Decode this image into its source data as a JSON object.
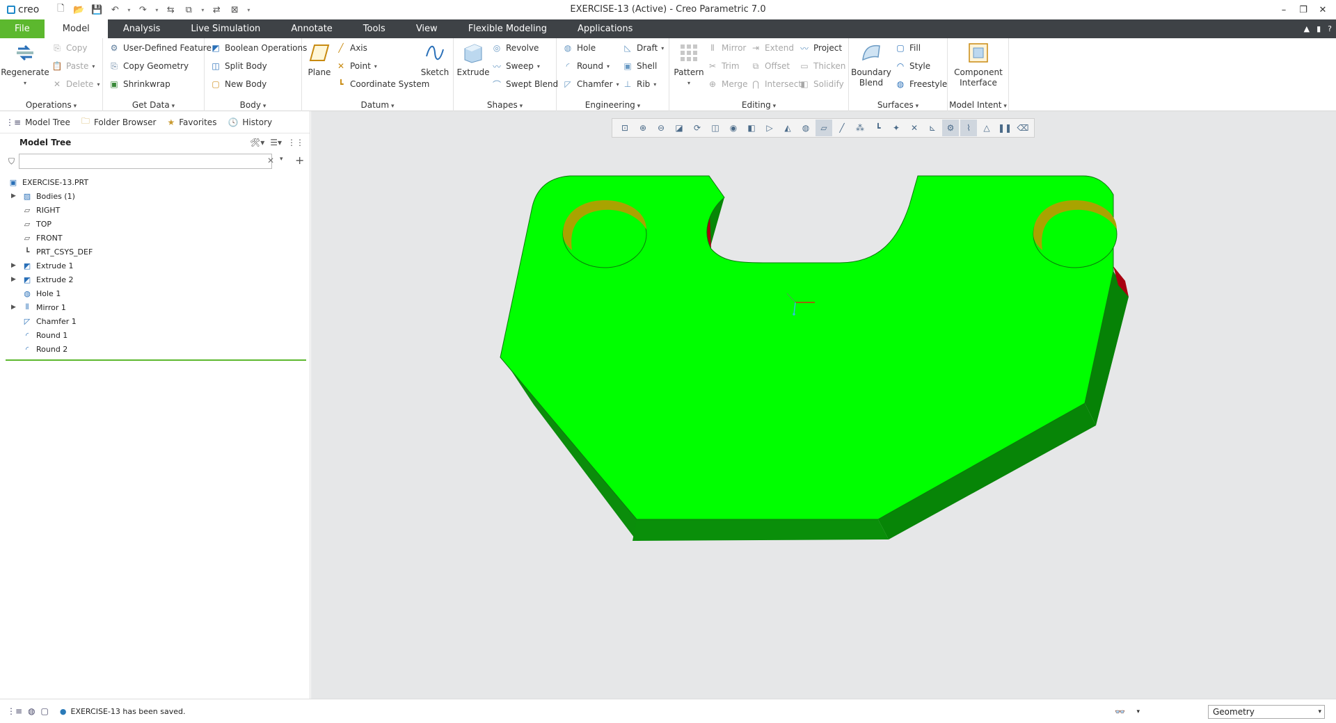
{
  "app": {
    "logo": "creo",
    "title": "EXERCISE-13 (Active) - Creo Parametric 7.0",
    "window_controls": [
      "–",
      "❐",
      "✕"
    ]
  },
  "tabs": [
    {
      "label": "File"
    },
    {
      "label": "Model"
    },
    {
      "label": "Analysis"
    },
    {
      "label": "Live Simulation"
    },
    {
      "label": "Annotate"
    },
    {
      "label": "Tools"
    },
    {
      "label": "View"
    },
    {
      "label": "Flexible Modeling"
    },
    {
      "label": "Applications"
    }
  ],
  "ribbon": {
    "operations": {
      "label": "Operations",
      "regenerate": "Regenerate",
      "copy": "Copy",
      "paste": "Paste",
      "delete": "Delete"
    },
    "get_data": {
      "label": "Get Data",
      "udf": "User-Defined Feature",
      "copy_geometry": "Copy Geometry",
      "shrinkwrap": "Shrinkwrap"
    },
    "body": {
      "label": "Body",
      "boolean": "Boolean Operations",
      "split": "Split Body",
      "new": "New Body"
    },
    "datum": {
      "label": "Datum",
      "plane": "Plane",
      "axis": "Axis",
      "point": "Point",
      "csys": "Coordinate System",
      "sketch": "Sketch"
    },
    "shapes": {
      "label": "Shapes",
      "extrude": "Extrude",
      "revolve": "Revolve",
      "sweep": "Sweep",
      "swept_blend": "Swept Blend"
    },
    "engineering": {
      "label": "Engineering",
      "hole": "Hole",
      "round": "Round",
      "chamfer": "Chamfer",
      "draft": "Draft",
      "shell": "Shell",
      "rib": "Rib"
    },
    "editing": {
      "label": "Editing",
      "pattern": "Pattern",
      "mirror": "Mirror",
      "trim": "Trim",
      "merge": "Merge",
      "extend": "Extend",
      "offset": "Offset",
      "intersect": "Intersect",
      "project": "Project",
      "thicken": "Thicken",
      "solidify": "Solidify"
    },
    "surfaces": {
      "label": "Surfaces",
      "boundary_blend_1": "Boundary",
      "boundary_blend_2": "Blend",
      "fill": "Fill",
      "style": "Style",
      "freestyle": "Freestyle"
    },
    "model_intent": {
      "label": "Model Intent",
      "component_1": "Component",
      "component_2": "Interface"
    }
  },
  "nav_tabs": [
    "Model Tree",
    "Folder Browser",
    "Favorites",
    "History"
  ],
  "model_tree": {
    "title": "Model Tree",
    "search_placeholder": "",
    "items": [
      {
        "label": "EXERCISE-13.PRT",
        "icon": "part-icon",
        "indent": 0,
        "expandable": false
      },
      {
        "label": "Bodies (1)",
        "icon": "bodies-icon",
        "indent": 1,
        "expandable": true
      },
      {
        "label": "RIGHT",
        "icon": "datum-plane-icon",
        "indent": 1,
        "expandable": false
      },
      {
        "label": "TOP",
        "icon": "datum-plane-icon",
        "indent": 1,
        "expandable": false
      },
      {
        "label": "FRONT",
        "icon": "datum-plane-icon",
        "indent": 1,
        "expandable": false
      },
      {
        "label": "PRT_CSYS_DEF",
        "icon": "csys-icon",
        "indent": 1,
        "expandable": false
      },
      {
        "label": "Extrude 1",
        "icon": "extrude-icon",
        "indent": 1,
        "expandable": true
      },
      {
        "label": "Extrude 2",
        "icon": "extrude-icon",
        "indent": 1,
        "expandable": true
      },
      {
        "label": "Hole 1",
        "icon": "hole-icon",
        "indent": 1,
        "expandable": false
      },
      {
        "label": "Mirror 1",
        "icon": "mirror-icon",
        "indent": 1,
        "expandable": true
      },
      {
        "label": "Chamfer 1",
        "icon": "chamfer-icon",
        "indent": 1,
        "expandable": false
      },
      {
        "label": "Round 1",
        "icon": "round-icon",
        "indent": 1,
        "expandable": false
      },
      {
        "label": "Round 2",
        "icon": "round-icon",
        "indent": 1,
        "expandable": false
      }
    ]
  },
  "status": {
    "message": "EXERCISE-13 has been saved.",
    "filter": "Geometry"
  },
  "colors": {
    "file_tab": "#5cb82e",
    "tabbar": "#3e4246",
    "part_top": "#00ff00",
    "part_side": "#0a8a0a",
    "hole_wall": "#a8a000",
    "edge_red": "#a80010",
    "viewport_bg": "#e6e7e8"
  }
}
